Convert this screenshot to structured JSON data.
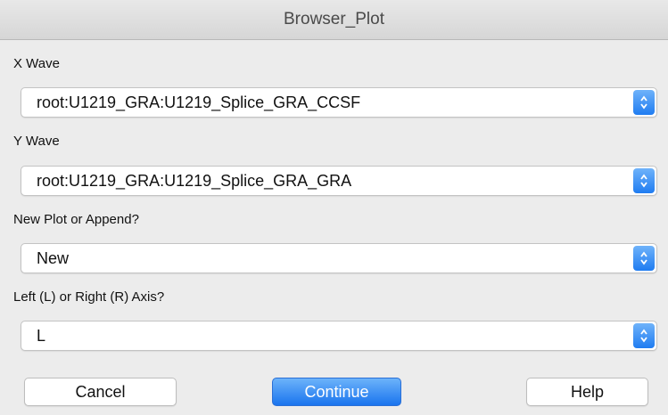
{
  "window": {
    "title": "Browser_Plot"
  },
  "fields": [
    {
      "label": "X Wave",
      "value": "root:U1219_GRA:U1219_Splice_GRA_CCSF"
    },
    {
      "label": "Y Wave",
      "value": "root:U1219_GRA:U1219_Splice_GRA_GRA"
    },
    {
      "label": "New Plot or Append?",
      "value": "New"
    },
    {
      "label": "Left (L) or Right (R) Axis?",
      "value": "L"
    }
  ],
  "buttons": {
    "cancel": "Cancel",
    "continue": "Continue",
    "help": "Help"
  },
  "colors": {
    "accent": "#1f7cf1",
    "background": "#ececec"
  },
  "icons": {
    "stepper": "up-down-chevron-icon"
  }
}
